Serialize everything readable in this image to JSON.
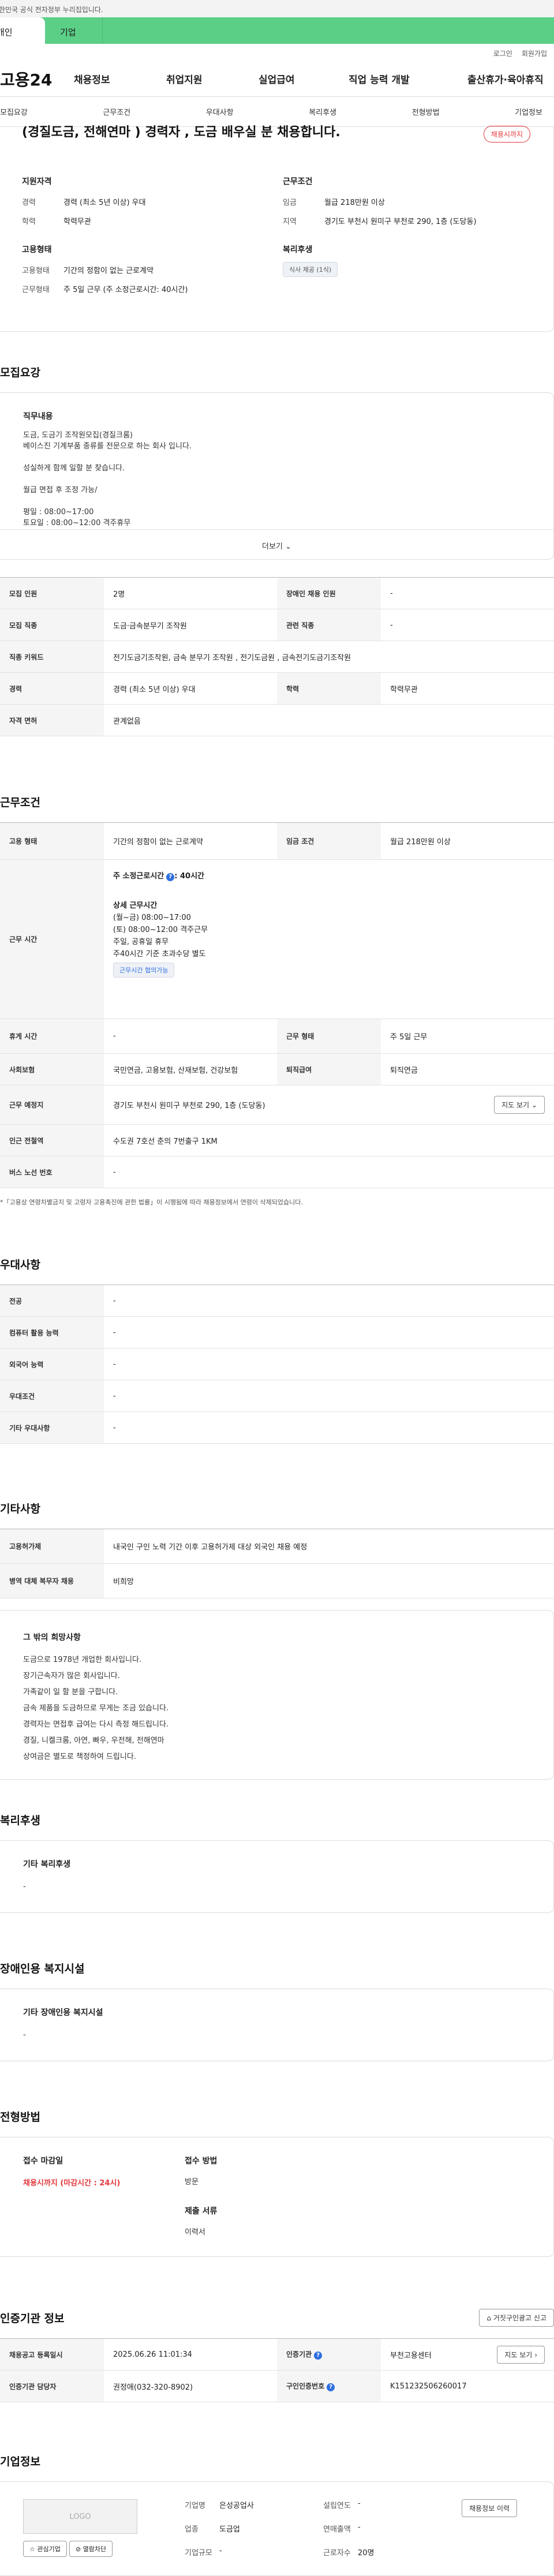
{
  "banner": {
    "text": "이 누리집은 대한민국 공식 전자정부 누리집입니다."
  },
  "site_tabs": [
    "개인",
    "기업"
  ],
  "util": {
    "login": "로그인",
    "join": "회원가입"
  },
  "logo": "고용24",
  "gnb": [
    "채용정보",
    "취업지원",
    "실업급여",
    "직업 능력 개발",
    "출산휴가·육아휴직"
  ],
  "subnav": [
    "모집요강",
    "근무조건",
    "우대사항",
    "복리후생",
    "전형방법",
    "기업정보"
  ],
  "job": {
    "title": "(경질도금, 전해연마 ) 경력자 , 도금 배우실 분 채용합니다.",
    "deadline_badge": "채용시까지",
    "summary": {
      "applicant_head": "지원자격",
      "career_label": "경력",
      "career_value": "경력 (최소 5년 이상) 우대",
      "edu_label": "학력",
      "edu_value": "학력무관",
      "employ_head": "고용형태",
      "employ_type_label": "고용형태",
      "employ_type_value": "기간의 정함이 없는 근로계약",
      "work_label": "근무형태",
      "work_value": "주 5일 근무 (주 소정근로시간: 40시간)",
      "cond_head": "근무조건",
      "wage_label": "임금",
      "wage_value": "월급 218만원 이상",
      "region_label": "지역",
      "region_value": "경기도 부천시 원미구 부천로 290, 1층 (도당동)",
      "welfare_head": "복리후생",
      "welfare_tag": "식사 제공 (1식)"
    }
  },
  "recruit": {
    "title": "모집요강",
    "desc_head": "직무내용",
    "desc_lines": [
      "도금, 도금기 조작원모집(경질크롬)",
      "베이스진 기계부품 종류를 전문으로 하는 회사 입니다.",
      "",
      "성실하게 함께 일할 분 찾습니다.",
      "",
      "월급 면접 후 조정 가능/",
      "",
      "평일 : 08:00~17:00",
      "토요일 : 08:00~12:00 격주휴무"
    ],
    "more": "더보기",
    "rows": [
      {
        "k1": "모집 인원",
        "v1": "2명",
        "k2": "장애인 채용 인원",
        "v2": "-"
      },
      {
        "k1": "모집 직종",
        "v1": "도금·금속분무기 조작원",
        "k2": "관련 직종",
        "v2": "-"
      },
      {
        "k1": "직종 키워드",
        "v1": "전기도금기조작원, 금속 분무기 조작원 , 전기도금원 , 금속전기도금기조작원",
        "k2": "",
        "v2": ""
      },
      {
        "k1": "경력",
        "v1": "경력 (최소 5년 이상) 우대",
        "k2": "학력",
        "v2": "학력무관"
      },
      {
        "k1": "자격 면허",
        "v1": "관계없음",
        "k2": "",
        "v2": ""
      }
    ]
  },
  "conditions": {
    "title": "근무조건",
    "employ_type_label": "고용 형태",
    "employ_type_value": "기간의 정함이 없는 근로계약",
    "wage_label": "임금 조건",
    "wage_value": "월급 218만원 이상",
    "hours_label": "근무 시간",
    "hours_week": "주 소정근로시간",
    "hours_week_value": ": 40시간",
    "hours_detail_head": "상세 근무시간",
    "hours_detail": [
      "(월~금) 08:00~17:00",
      "(토)  08:00~12:00 격주근무",
      "주일, 공휴일 휴무",
      "주40시간 기준 초과수당 별도"
    ],
    "hours_tag": "근무시간 협의가능",
    "break_label": "휴게 시간",
    "break_value": "-",
    "work_type_label": "근무 형태",
    "work_type_value": "주 5일 근무",
    "insurance_label": "사회보험",
    "insurance_value": "국민연금, 고용보험, 산재보험, 건강보험",
    "retire_label": "퇴직급여",
    "retire_value": "퇴직연금",
    "location_label": "근무 예정지",
    "location_value": "경기도 부천시 원미구 부천로 290, 1층 (도당동)",
    "map_btn": "지도 보기",
    "subway_label": "인근 전철역",
    "subway_value": "수도권 7호선 춘의 7번출구 1KM",
    "bus_label": "버스 노선 번호",
    "bus_value": "-",
    "note": "*「고용상 연령차별금지 및 고령자 고용촉진에 관한 법률」이 시행됨에 따라 채용정보에서 연령이 삭제되었습니다."
  },
  "preference": {
    "title": "우대사항",
    "rows": [
      {
        "k": "전공",
        "v": "-"
      },
      {
        "k": "컴퓨터 활용 능력",
        "v": "-"
      },
      {
        "k": "외국어 능력",
        "v": "-"
      },
      {
        "k": "우대조건",
        "v": "-"
      },
      {
        "k": "기타 우대사항",
        "v": "-"
      }
    ]
  },
  "etc": {
    "title": "기타사항",
    "rows": [
      {
        "k": "고용허가제",
        "v": "내국인 구인 노력 기간 이후 고용허가제 대상 외국인 채용 예정"
      },
      {
        "k": "병역 대체 복무자 채용",
        "v": "비희망"
      }
    ],
    "free_head": "그 밖의 희망사항",
    "free_lines": [
      "도금으로 1978년  개업한 회사입니다.",
      "장기근속자가 많은 회사입니다.",
      "가족같이 일 할 분을 구합니다.",
      "금속 제품을 도금하므로 무게는 조금 있습니다.",
      "경력자는 면접후 급여는 다시 측정 해드립니다.",
      "경질, 니켈크롬, 아연, 빠우, 우전해, 전해연마",
      "상여금은 별도로 책정하여 드립니다."
    ]
  },
  "welfare": {
    "title": "복리후생",
    "head": "기타 복리후생",
    "value": "-"
  },
  "disabled": {
    "title": "장애인용 복지시설",
    "head": "기타 장애인용 복지시설",
    "value": "-"
  },
  "method": {
    "title": "전형방법",
    "deadline_head": "접수 마감일",
    "deadline_value": "채용시까지 (마감시간 : 24시)",
    "apply_head": "접수 방법",
    "apply_value": "방문",
    "docs_head": "제출 서류",
    "docs_value": "이력서"
  },
  "agency": {
    "title": "인증기관 정보",
    "report_btn": "거짓구인광고 신고",
    "reg_date_label": "채용공고 등록일시",
    "reg_date_value": "2025.06.26 11:01:34",
    "agency_label": "인증기관",
    "agency_value": "부천고용센터",
    "map_btn": "지도 보기",
    "manager_label": "인증기관 담당자",
    "manager_value": "권정애(032-320-8902)",
    "id_label": "구인인증번호",
    "id_value": "K151232506260017"
  },
  "company": {
    "title": "기업정보",
    "logo_text": "LOGO",
    "fav_btn": "관심기업",
    "block_btn": "열람차단",
    "name_label": "기업명",
    "name_value": "은성공업사",
    "industry_label": "업종",
    "industry_value": "도금업",
    "scale_label": "기업규모",
    "scale_value": "-",
    "founded_label": "설립연도",
    "founded_value": "-",
    "sales_label": "연매출액",
    "sales_value": "-",
    "staff_label": "근로자수",
    "staff_value": "20명",
    "history_btn": "채용정보 이력"
  },
  "colors": {
    "brand_green": "#5ccf87",
    "deadline_red": "#e4383c",
    "info_blue": "#2f6fe0"
  }
}
